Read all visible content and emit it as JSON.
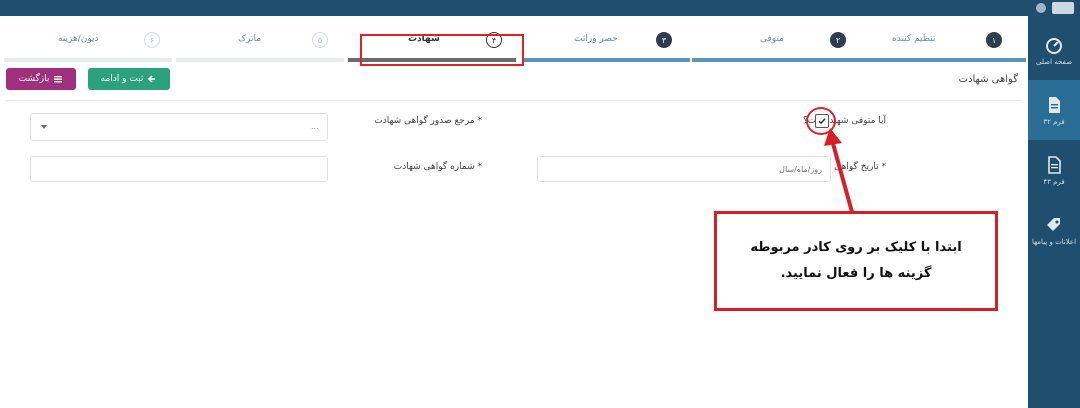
{
  "colors": {
    "sidebar": "#1f4e6e",
    "accent_red": "#d71f27",
    "save_button": "#2aa37c",
    "back_button": "#a0307e",
    "step_done_bar": "#5b95bd"
  },
  "sidebar": {
    "items": [
      {
        "label": "صفحه اصلی",
        "icon": "dashboard-icon",
        "active": false
      },
      {
        "label": "فرم ۳۲",
        "icon": "document-icon",
        "active": true
      },
      {
        "label": "فرم ۴۳",
        "icon": "document-outline-icon",
        "active": false
      },
      {
        "label": "اعلانات و پیامها",
        "icon": "tag-icon",
        "active": false
      }
    ]
  },
  "wizard": {
    "steps": [
      {
        "num": "۱",
        "label": "تنظیم کننده",
        "state": "done"
      },
      {
        "num": "۲",
        "label": "متوفی",
        "state": "done"
      },
      {
        "num": "۳",
        "label": "حصر وراثت",
        "state": "done"
      },
      {
        "num": "۴",
        "label": "شهادت",
        "state": "current"
      },
      {
        "num": "۵",
        "label": "ماترک",
        "state": "todo"
      },
      {
        "num": "۶",
        "label": "دیون/هزینه",
        "state": "todo"
      }
    ]
  },
  "toolbar": {
    "save_label": "ثبت و ادامه",
    "back_label": "بازگشت"
  },
  "form": {
    "section_title": "گواهی شهادت",
    "martyr_question": "آیا متوفی شهید است؟",
    "martyr_checked": true,
    "issuer_label": "مرجع صدور گواهی شهادت *",
    "issuer_placeholder": "...",
    "cert_date_label": "تاریخ گواهی شهادت *",
    "cert_date_placeholder": "روز/ماه/سال",
    "cert_number_label": "شماره گواهی شهادت *",
    "cert_number_value": ""
  },
  "callout": {
    "line1": "ابتدا با کلیک بر روی کادر مربوطه",
    "line2": "گزینه ها را فعال نمایید."
  }
}
